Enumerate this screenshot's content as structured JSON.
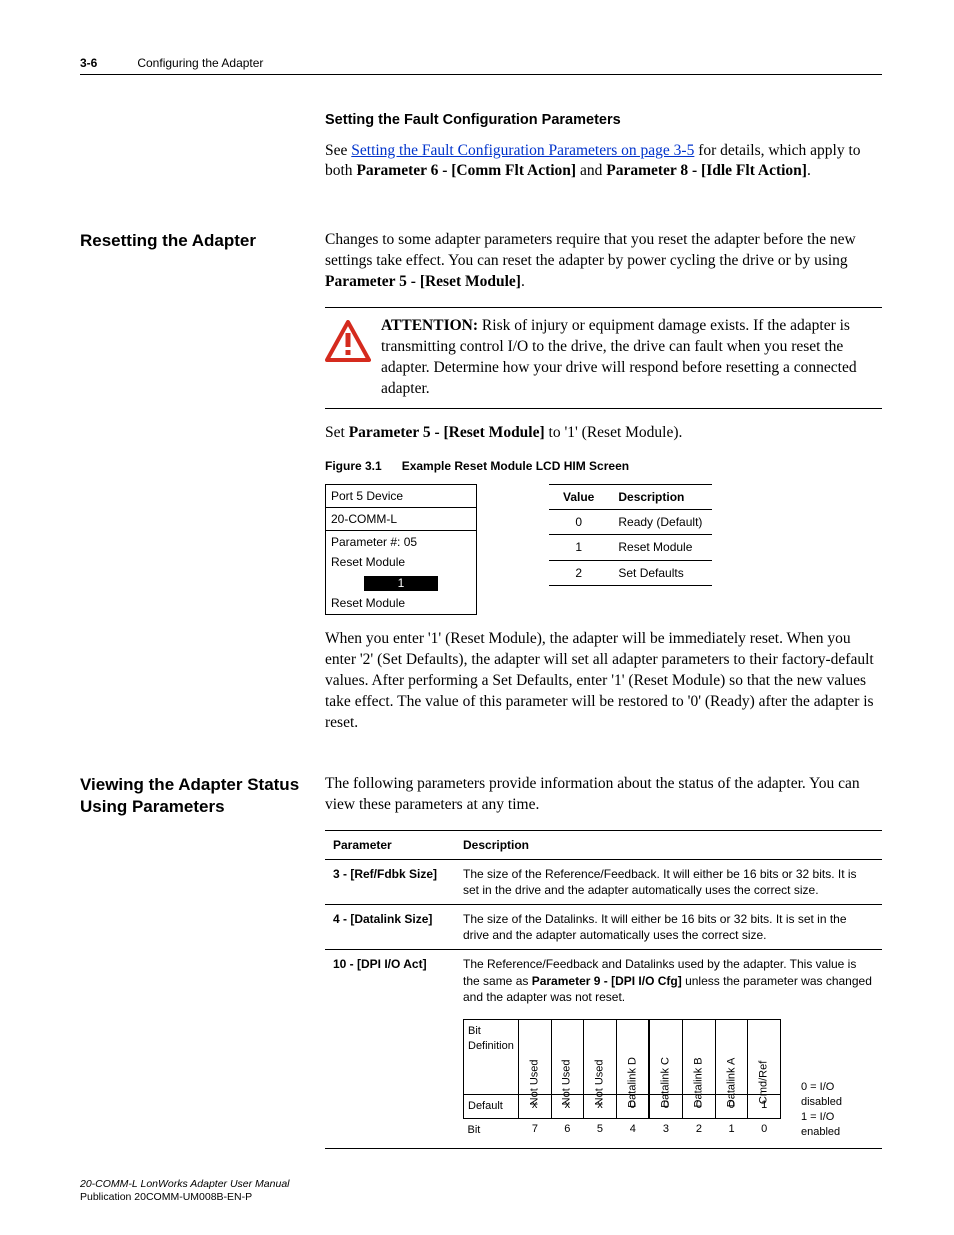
{
  "header": {
    "page": "3-6",
    "chapter": "Configuring the Adapter"
  },
  "sec1": {
    "heading": "Setting the Fault Configuration Parameters",
    "see_pre": "See ",
    "link": "Setting the Fault Configuration Parameters on page 3-5",
    "see_post": " for details, which apply to both ",
    "b1": "Parameter 6 - [Comm Flt Action]",
    "mid": " and ",
    "b2": "Parameter 8 - [Idle Flt Action]",
    "end": "."
  },
  "sec2": {
    "side": "Resetting the Adapter",
    "p_pre": "Changes to some adapter parameters require that you reset the adapter before the new settings take effect. You can reset the adapter by power cycling the drive or by using ",
    "p_b": "Parameter 5 - [Reset Module]",
    "p_end": ".",
    "att_b": "ATTENTION:",
    "att": "  Risk of injury or equipment damage exists. If the adapter is transmitting control I/O to the drive, the drive can fault when you reset the adapter. Determine how your drive will respond before resetting a connected adapter.",
    "set_pre": "Set ",
    "set_b": "Parameter 5 - [Reset Module]",
    "set_post": " to '1' (Reset Module).",
    "fig_num": "Figure 3.1",
    "fig_title": "Example Reset Module LCD HIM Screen",
    "him": {
      "l1": "Port 5 Device",
      "l2": "20-COMM-L",
      "l3": "Parameter #: 05",
      "l4": "Reset Module",
      "val": "1",
      "l5": "Reset Module"
    },
    "vt_h1": "Value",
    "vt_h2": "Description",
    "vt": [
      {
        "v": "0",
        "d": "Ready (Default)"
      },
      {
        "v": "1",
        "d": "Reset Module"
      },
      {
        "v": "2",
        "d": "Set Defaults"
      }
    ],
    "p2": "When you enter '1' (Reset Module), the adapter will be immediately reset. When you enter '2' (Set Defaults), the adapter will set all adapter parameters to their factory-default values. After performing a Set Defaults, enter '1' (Reset Module) so that the new values take effect. The value of this parameter will be restored to '0' (Ready) after the adapter is reset."
  },
  "sec3": {
    "side": "Viewing the Adapter Status Using Parameters",
    "p": "The following parameters provide information about the status of the adapter. You can view these parameters at any time.",
    "pt_h1": "Parameter",
    "pt_h2": "Description",
    "row1_p": "3 - [Ref/Fdbk Size]",
    "row1_d": "The size of the Reference/Feedback. It will either be 16 bits or 32 bits. It is set in the drive and the adapter automatically uses the correct size.",
    "row2_p": "4 - [Datalink Size]",
    "row2_d": "The size of the Datalinks. It will either be 16 bits or 32 bits. It is set in the drive and the adapter automatically uses the correct size.",
    "row3_p": "10 - [DPI I/O Act]",
    "row3_d_pre": "The Reference/Feedback and Datalinks used by the adapter. This value is the same as ",
    "row3_d_b": "Parameter 9 - [DPI I/O Cfg]",
    "row3_d_post": " unless the parameter was changed and the adapter was not reset.",
    "bits": {
      "lbl_def": "Bit\nDefinition",
      "heads": [
        "Not Used",
        "Not Used",
        "Not Used",
        "Datalink D",
        "Datalink C",
        "Datalink B",
        "Datalink A",
        "Cmd/Ref"
      ],
      "default_lbl": "Default",
      "defaults": [
        "x",
        "x",
        "x",
        "0",
        "0",
        "0",
        "0",
        "1"
      ],
      "bit_lbl": "Bit",
      "bitnums": [
        "7",
        "6",
        "5",
        "4",
        "3",
        "2",
        "1",
        "0"
      ],
      "legend0": "0 = I/O disabled",
      "legend1": "1 = I/O enabled"
    }
  },
  "footer": {
    "title": "20-COMM-L LonWorks Adapter User Manual",
    "pub": "Publication 20COMM-UM008B-EN-P"
  }
}
